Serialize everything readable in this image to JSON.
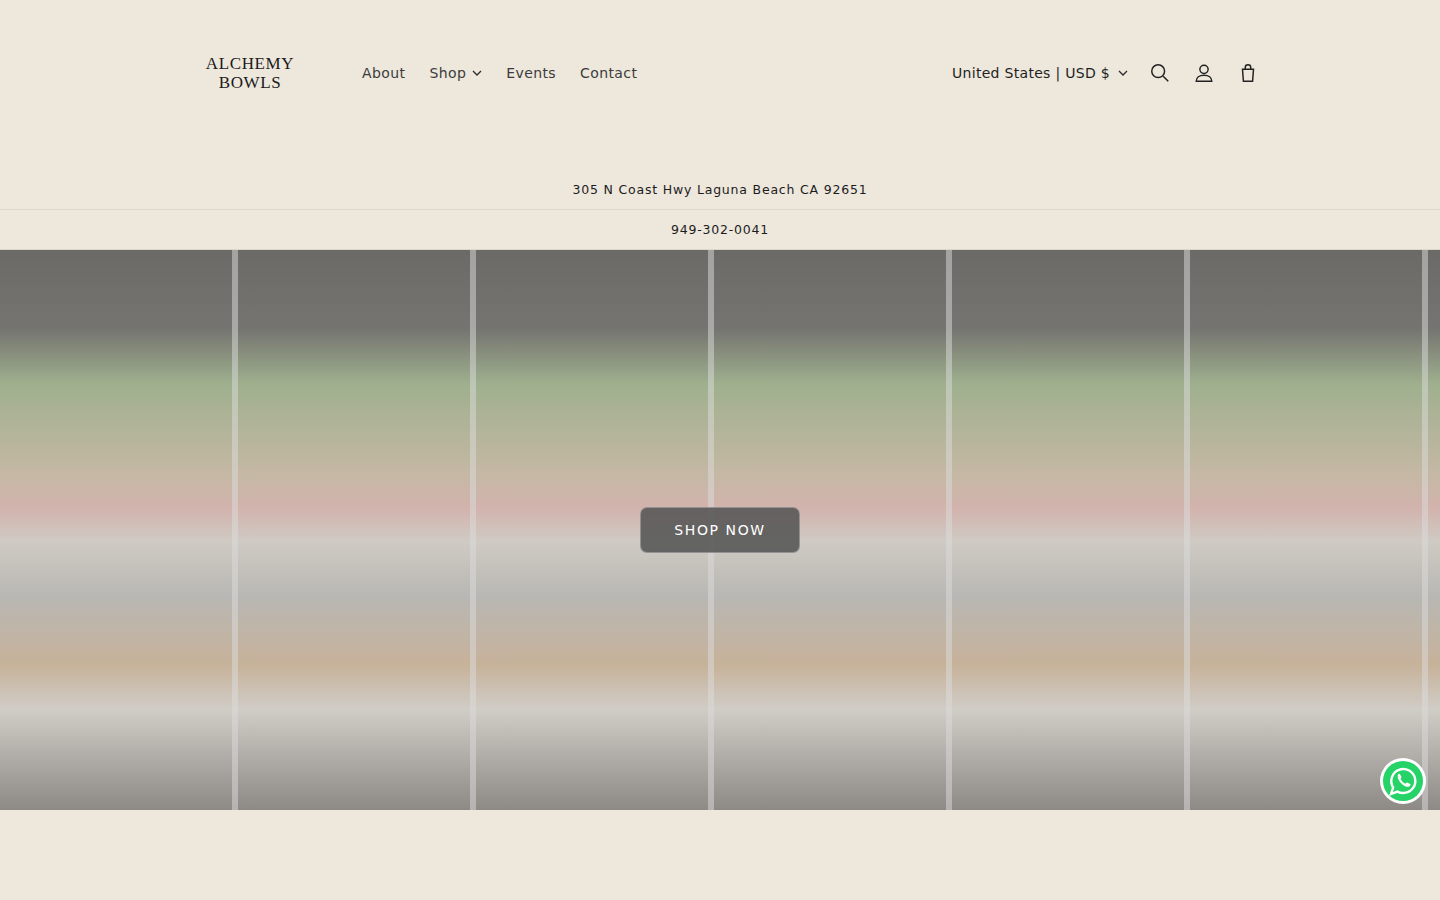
{
  "header": {
    "logo": [
      "ALCHEMY",
      "BOWLS"
    ],
    "nav": [
      {
        "label": "About",
        "kind": "link",
        "expanded": false
      },
      {
        "label": "Shop",
        "kind": "menu",
        "expanded": false
      },
      {
        "label": "Events",
        "kind": "link",
        "expanded": false
      },
      {
        "label": "Contact",
        "kind": "link",
        "expanded": false
      }
    ],
    "locale": {
      "label": "United States | USD $",
      "expanded": false
    }
  },
  "announcements": [
    "305 N Coast Hwy Laguna Beach CA 92651",
    "949-302-0041"
  ],
  "hero": {
    "button": "SHOP NOW"
  }
}
